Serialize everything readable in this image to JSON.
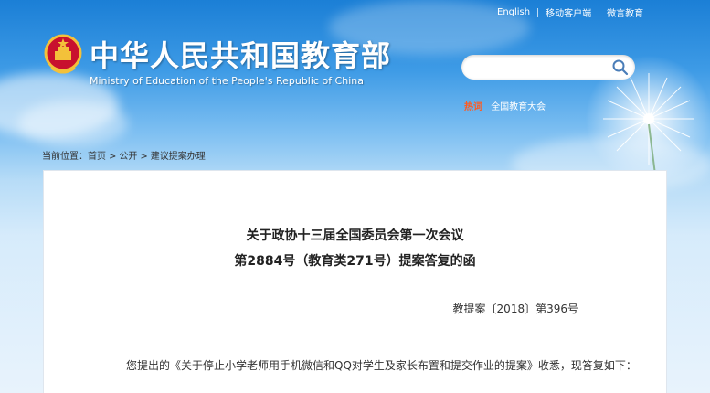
{
  "header": {
    "top_links": [
      "English",
      "移动客户端",
      "微言教育"
    ],
    "title_cn": "中华人民共和国教育部",
    "title_en": "Ministry of Education of the People's Republic of China",
    "emblem_icon": "national-emblem-icon"
  },
  "search": {
    "value": "",
    "placeholder": "",
    "icon": "search-icon"
  },
  "hot": {
    "label": "热词",
    "items": [
      "全国教育大会"
    ]
  },
  "breadcrumb": {
    "prefix": "当前位置：",
    "items": [
      "首页",
      "公开",
      "建议提案办理"
    ]
  },
  "document": {
    "title_line1": "关于政协十三届全国委员会第一次会议",
    "title_line2": "第2884号（教育类271号）提案答复的函",
    "doc_number": "教提案〔2018〕第396号",
    "paragraph": "您提出的《关于停止小学老师用手机微信和QQ对学生及家长布置和提交作业的提案》收悉，现答复如下："
  },
  "colors": {
    "sky_top": "#1b7fd6",
    "hot_label": "#ff5a1f",
    "panel_bg": "#ffffff"
  }
}
